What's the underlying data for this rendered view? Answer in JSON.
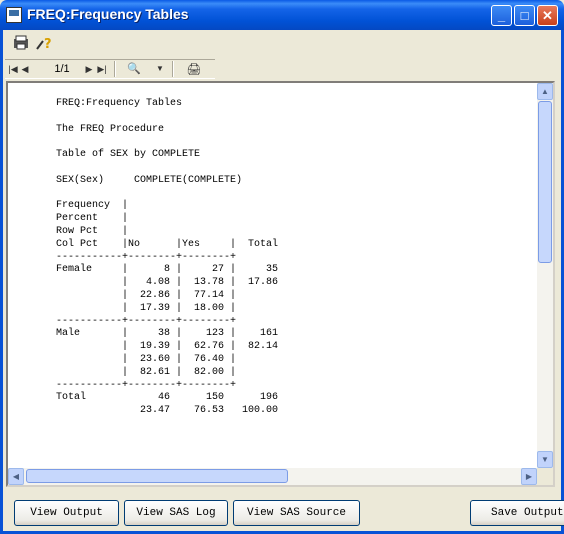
{
  "window": {
    "title": "FREQ:Frequency Tables",
    "controls": {
      "minimize": "_",
      "maximize": "□",
      "close": "✕"
    }
  },
  "toolbar": {
    "icons": [
      "save-print-icon",
      "help-icon"
    ]
  },
  "navigation": {
    "first": "|◀",
    "prev": "◀",
    "page": "1/1",
    "next": "▶",
    "last": "▶|",
    "search": "🔍",
    "dropdown": "▼",
    "print": "🖨"
  },
  "report": {
    "text": "FREQ:Frequency Tables\n\nThe FREQ Procedure\n\nTable of SEX by COMPLETE\n\nSEX(Sex)     COMPLETE(COMPLETE)\n\nFrequency  |\nPercent    |\nRow Pct    |\nCol Pct    |No      |Yes     |  Total\n-----------+--------+--------+\nFemale     |      8 |     27 |     35\n           |   4.08 |  13.78 |  17.86\n           |  22.86 |  77.14 |\n           |  17.39 |  18.00 |\n-----------+--------+--------+\nMale       |     38 |    123 |    161\n           |  19.39 |  62.76 |  82.14\n           |  23.60 |  76.40 |\n           |  82.61 |  82.00 |\n-----------+--------+--------+\nTotal            46      150      196\n              23.47    76.53   100.00"
  },
  "buttons": {
    "view_output": "View Output",
    "view_log": "View SAS Log",
    "view_source": "View SAS Source",
    "save_output": "Save Output"
  }
}
